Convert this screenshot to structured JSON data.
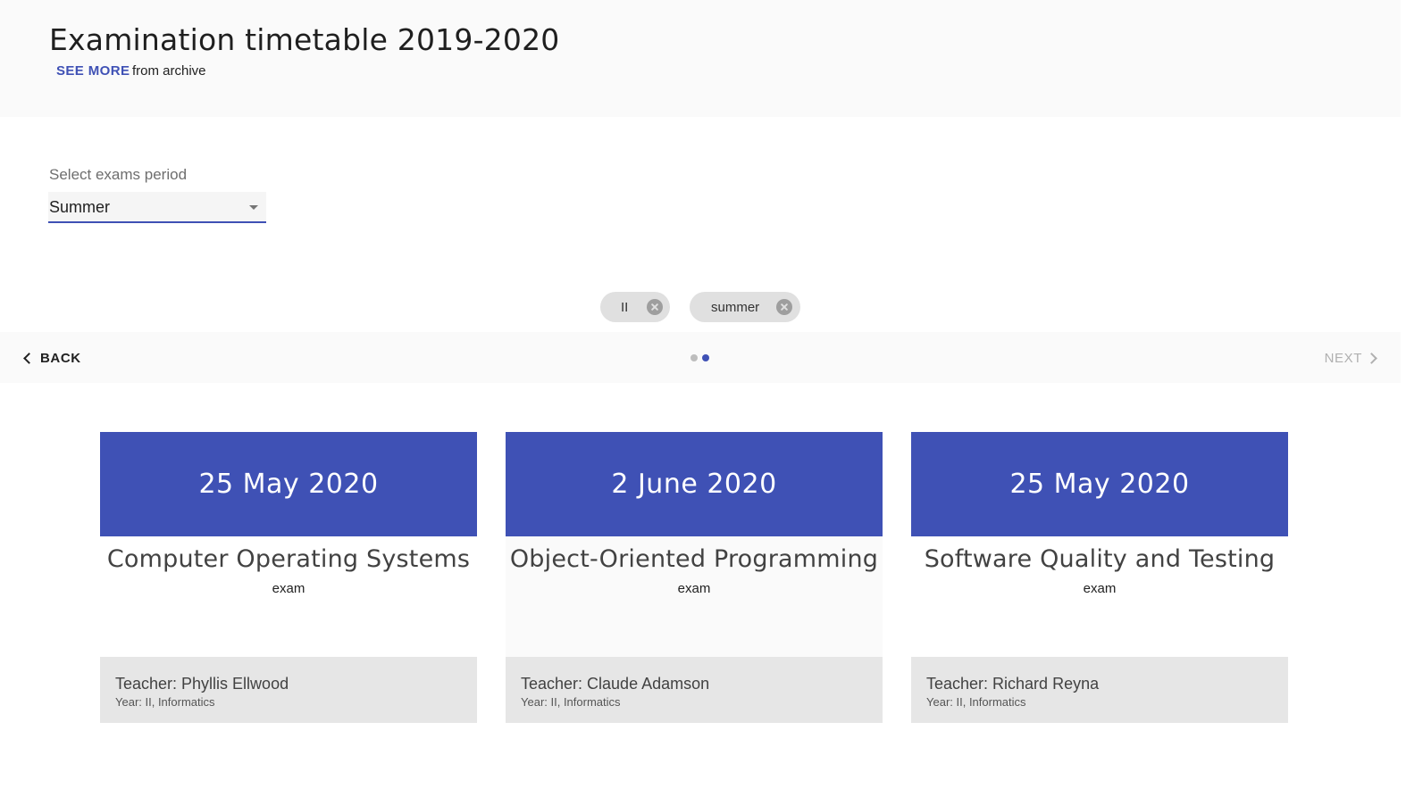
{
  "header": {
    "title": "Examination timetable 2019-2020",
    "see_more_label": "SEE MORE",
    "archive_text": "from archive"
  },
  "period_select": {
    "label": "Select exams period",
    "value": "Summer"
  },
  "filters": {
    "chips": [
      {
        "label": "II"
      },
      {
        "label": "summer"
      }
    ]
  },
  "stepper": {
    "back_label": "BACK",
    "next_label": "NEXT",
    "total_steps": 2,
    "active_step": 2
  },
  "colors": {
    "accent": "#3f51b5",
    "chip_bg": "#e0e0e0",
    "card_footer_bg": "#e6e6e6"
  },
  "exams": [
    {
      "date": "25 May 2020",
      "subject": "Computer Operating Systems",
      "type": "exam",
      "teacher": "Teacher: Phyllis Ellwood",
      "year": "Year: II, Informatics"
    },
    {
      "date": "2 June 2020",
      "subject": "Object-Oriented Programming",
      "type": "exam",
      "teacher": "Teacher: Claude Adamson",
      "year": "Year: II, Informatics"
    },
    {
      "date": "25 May 2020",
      "subject": "Software Quality and Testing",
      "type": "exam",
      "teacher": "Teacher: Richard Reyna",
      "year": "Year: II, Informatics"
    }
  ]
}
